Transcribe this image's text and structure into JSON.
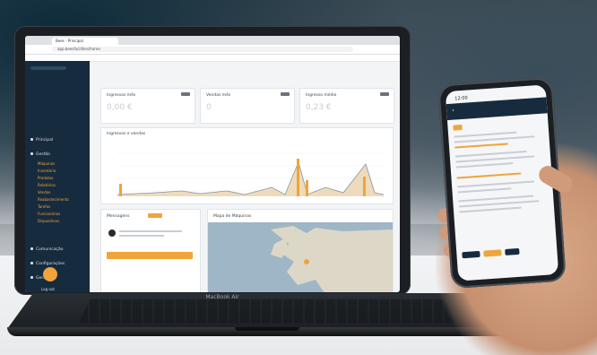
{
  "laptop": {
    "brand_label": "MacBook Air",
    "browser": {
      "tab_label": "Bees - Principal",
      "url": "app.beesfacilities/home"
    },
    "sidebar": {
      "items": [
        {
          "label": "Principal"
        },
        {
          "label": "Gestão"
        },
        {
          "label": "Máquinas",
          "sub": true
        },
        {
          "label": "Inventário",
          "sub": true
        },
        {
          "label": "Produtos",
          "sub": true
        },
        {
          "label": "Relatórios",
          "sub": true
        },
        {
          "label": "Vendas",
          "sub": true
        },
        {
          "label": "Reabastecimento",
          "sub": true
        },
        {
          "label": "Tarefas",
          "sub": true
        },
        {
          "label": "Funcionários",
          "sub": true
        },
        {
          "label": "Dispositivos",
          "sub": true
        },
        {
          "label": "Comunicação"
        },
        {
          "label": "Configurações"
        },
        {
          "label": "Gerais"
        }
      ],
      "logout_label": "Log out"
    },
    "cards": [
      {
        "label": "Ingressos mês",
        "value": "0,00 €"
      },
      {
        "label": "Vendas mês",
        "value": "0"
      },
      {
        "label": "Ingresso médio",
        "value": "0,23 €"
      }
    ],
    "chart": {
      "title": "Ingressos e vendas"
    },
    "orders_card": {
      "title": "Mensagens",
      "button_label": ""
    },
    "map_card": {
      "title": "Mapa de Máquinas"
    }
  },
  "phone": {
    "status_time": "12:00",
    "header_title": "",
    "button_labels": [
      "",
      "",
      ""
    ]
  },
  "colors": {
    "accent": "#f0a43b",
    "sidebar": "#162b3e"
  }
}
